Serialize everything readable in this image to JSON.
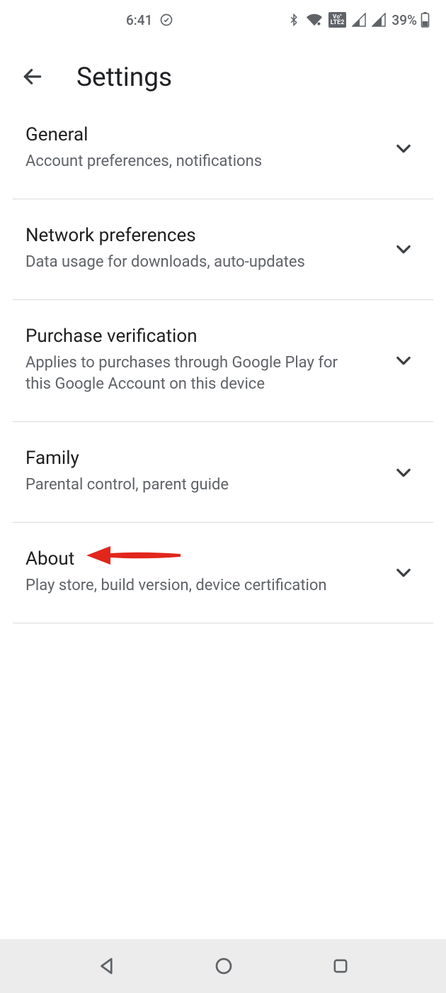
{
  "status": {
    "time": "6:41",
    "battery_pct": "39%"
  },
  "header": {
    "title": "Settings"
  },
  "rows": [
    {
      "title": "General",
      "subtitle": "Account preferences, notifications"
    },
    {
      "title": "Network preferences",
      "subtitle": "Data usage for downloads, auto-updates"
    },
    {
      "title": "Purchase verification",
      "subtitle": "Applies to purchases through Google Play for this Google Account on this device"
    },
    {
      "title": "Family",
      "subtitle": "Parental control, parent guide"
    },
    {
      "title": "About",
      "subtitle": "Play store, build version, device certification"
    }
  ],
  "annotation": {
    "target_row_index": 4,
    "direction": "left-pointing",
    "color": "#e1261c"
  }
}
